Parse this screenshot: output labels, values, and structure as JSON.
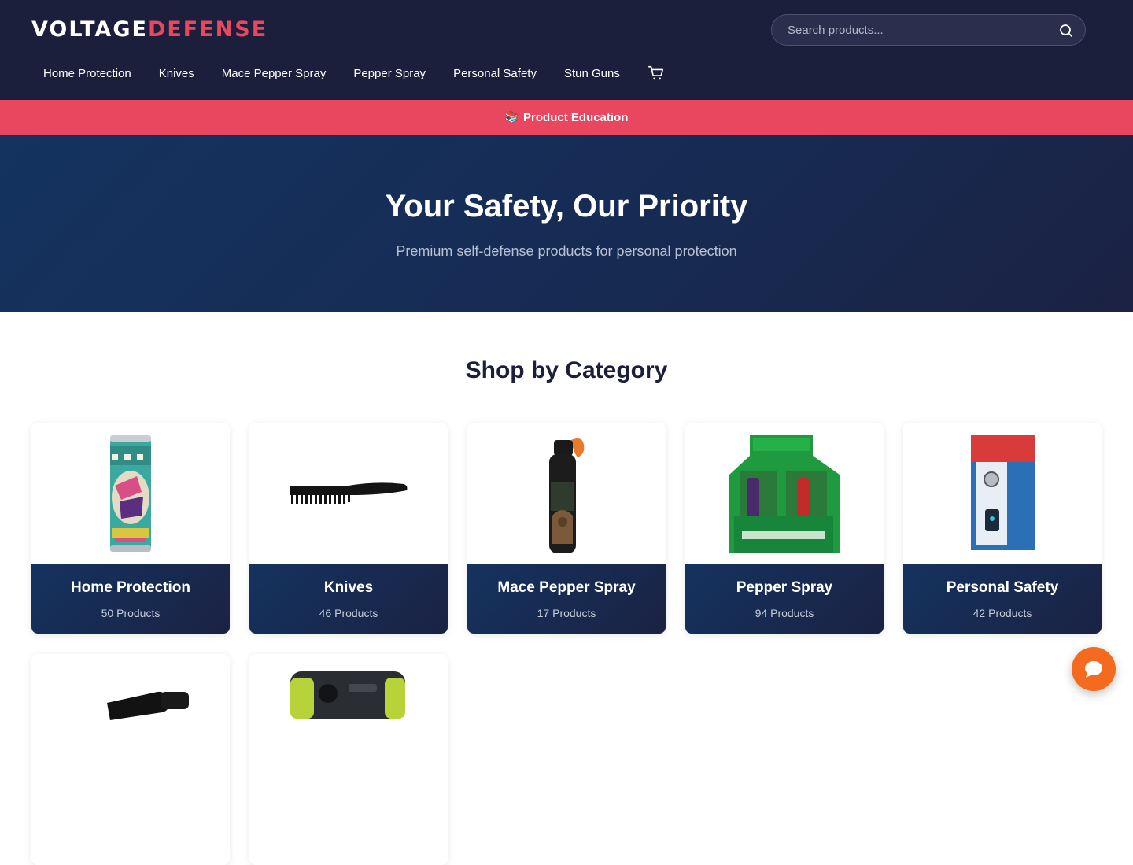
{
  "header": {
    "logo_part1": "VOLTAGE",
    "logo_part2": "DEFENSE",
    "search_placeholder": "Search products...",
    "nav": [
      "Home Protection",
      "Knives",
      "Mace Pepper Spray",
      "Pepper Spray",
      "Personal Safety",
      "Stun Guns"
    ]
  },
  "banner": {
    "icon": "📚",
    "label": "Product Education"
  },
  "hero": {
    "title": "Your Safety, Our Priority",
    "subtitle": "Premium self-defense products for personal protection"
  },
  "categories": {
    "title": "Shop by Category",
    "items": [
      {
        "name": "Home Protection",
        "count": "50 Products",
        "image": "beverage-can-safe"
      },
      {
        "name": "Knives",
        "count": "46 Products",
        "image": "comb-knife"
      },
      {
        "name": "Mace Pepper Spray",
        "count": "17 Products",
        "image": "bear-spray-canister"
      },
      {
        "name": "Pepper Spray",
        "count": "94 Products",
        "image": "pepper-shot-display-box"
      },
      {
        "name": "Personal Safety",
        "count": "42 Products",
        "image": "home-security-alarm"
      },
      {
        "name": "",
        "count": "",
        "image": "flashlight"
      },
      {
        "name": "",
        "count": "",
        "image": "stun-device"
      }
    ]
  },
  "colors": {
    "header_bg": "#1b1f3b",
    "accent": "#e8475f",
    "hero_bg": "#14335f",
    "chat_button": "#f46b1f"
  },
  "icons": {
    "search": "search-icon",
    "cart": "cart-icon",
    "chat": "chat-icon"
  }
}
